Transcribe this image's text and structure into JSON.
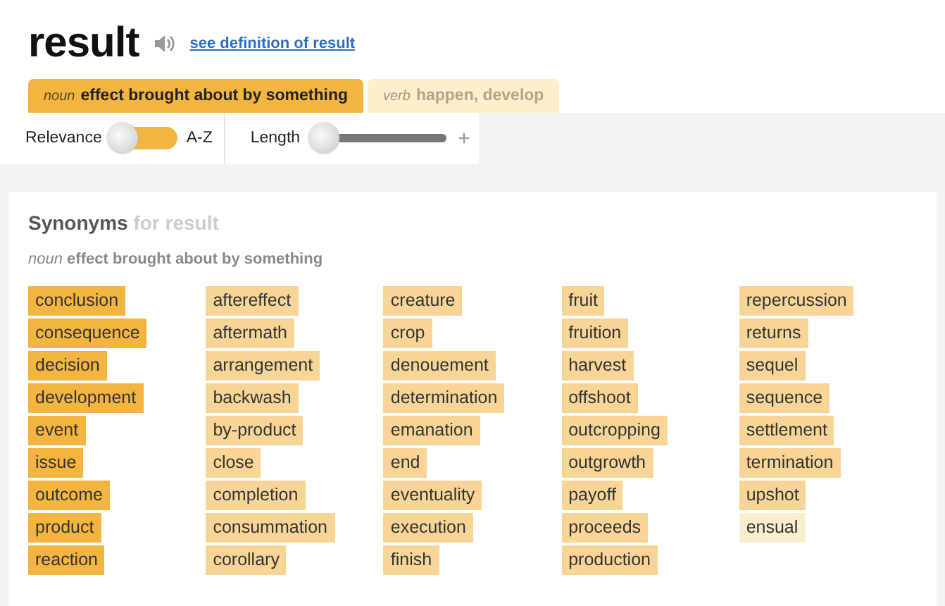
{
  "word": "result",
  "definition_link": "see definition of result",
  "tabs": [
    {
      "pos": "noun",
      "meaning": "effect brought about by something",
      "selected": true
    },
    {
      "pos": "verb",
      "meaning": "happen, develop",
      "selected": false
    }
  ],
  "sort": {
    "left_label": "Relevance",
    "right_label": "A-Z",
    "on": false
  },
  "length": {
    "label": "Length",
    "level": 0,
    "plus": "+"
  },
  "synonyms": {
    "heading": "Synonyms",
    "heading_suffix": "for result",
    "pos": "noun",
    "meaning": "effect brought about by something",
    "columns": [
      [
        {
          "text": "conclusion",
          "color": "#f3b53f"
        },
        {
          "text": "consequence",
          "color": "#f3b53f"
        },
        {
          "text": "decision",
          "color": "#f3b53f"
        },
        {
          "text": "development",
          "color": "#f3b53f"
        },
        {
          "text": "event",
          "color": "#f3b53f"
        },
        {
          "text": "issue",
          "color": "#f3b53f"
        },
        {
          "text": "outcome",
          "color": "#f3b53f"
        },
        {
          "text": "product",
          "color": "#f3b53f"
        },
        {
          "text": "reaction",
          "color": "#f3b53f"
        }
      ],
      [
        {
          "text": "aftereffect",
          "color": "#f8d597"
        },
        {
          "text": "aftermath",
          "color": "#f8d597"
        },
        {
          "text": "arrangement",
          "color": "#f8d597"
        },
        {
          "text": "backwash",
          "color": "#f8d597"
        },
        {
          "text": "by-product",
          "color": "#f8d597"
        },
        {
          "text": "close",
          "color": "#f8d597"
        },
        {
          "text": "completion",
          "color": "#f8d597"
        },
        {
          "text": "consummation",
          "color": "#f8d597"
        },
        {
          "text": "corollary",
          "color": "#f8d597"
        }
      ],
      [
        {
          "text": "creature",
          "color": "#f8d597"
        },
        {
          "text": "crop",
          "color": "#f8d597"
        },
        {
          "text": "denouement",
          "color": "#f8d597"
        },
        {
          "text": "determination",
          "color": "#f8d597"
        },
        {
          "text": "emanation",
          "color": "#f8d597"
        },
        {
          "text": "end",
          "color": "#f8d597"
        },
        {
          "text": "eventuality",
          "color": "#f8d597"
        },
        {
          "text": "execution",
          "color": "#f8d597"
        },
        {
          "text": "finish",
          "color": "#f8d597"
        }
      ],
      [
        {
          "text": "fruit",
          "color": "#f8d597"
        },
        {
          "text": "fruition",
          "color": "#f8d597"
        },
        {
          "text": "harvest",
          "color": "#f8d597"
        },
        {
          "text": "offshoot",
          "color": "#f8d597"
        },
        {
          "text": "outcropping",
          "color": "#f8d597"
        },
        {
          "text": "outgrowth",
          "color": "#f8d597"
        },
        {
          "text": "payoff",
          "color": "#f8d597"
        },
        {
          "text": "proceeds",
          "color": "#f8d597"
        },
        {
          "text": "production",
          "color": "#f8d597"
        }
      ],
      [
        {
          "text": "repercussion",
          "color": "#f8d597"
        },
        {
          "text": "returns",
          "color": "#f8d597"
        },
        {
          "text": "sequel",
          "color": "#f8d597"
        },
        {
          "text": "sequence",
          "color": "#f8d597"
        },
        {
          "text": "settlement",
          "color": "#f8d597"
        },
        {
          "text": "termination",
          "color": "#f8d597"
        },
        {
          "text": "upshot",
          "color": "#f8d597"
        },
        {
          "text": "ensual",
          "color": "#fcedcf"
        }
      ]
    ]
  }
}
